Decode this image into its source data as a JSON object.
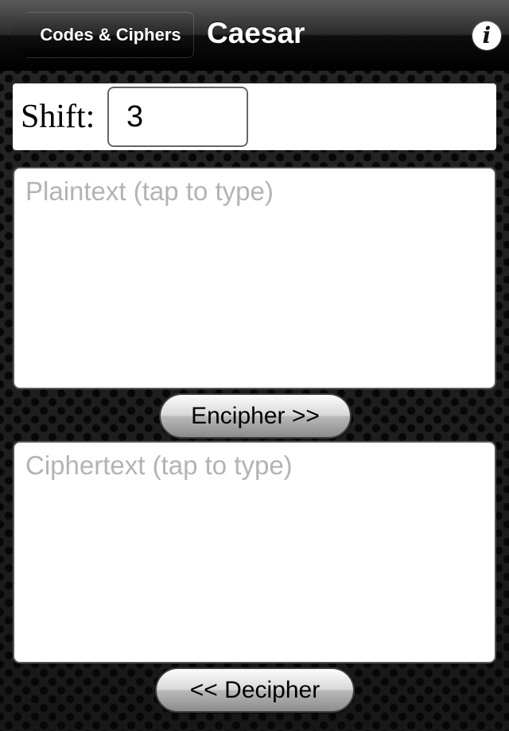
{
  "navbar": {
    "back_label": "Codes & Ciphers",
    "title": "Caesar",
    "info_glyph": "i",
    "info_icon": "info-icon"
  },
  "shift": {
    "label": "Shift:",
    "value": "3"
  },
  "plaintext": {
    "placeholder": "Plaintext (tap to type)",
    "value": ""
  },
  "ciphertext": {
    "placeholder": "Ciphertext (tap to type)",
    "value": ""
  },
  "actions": {
    "encipher_label": "Encipher >>",
    "decipher_label": "<< Decipher"
  },
  "colors": {
    "navbar": "#000000",
    "background": "#1c1c1c",
    "panel": "#ffffff",
    "placeholder": "#b3b3b3"
  }
}
